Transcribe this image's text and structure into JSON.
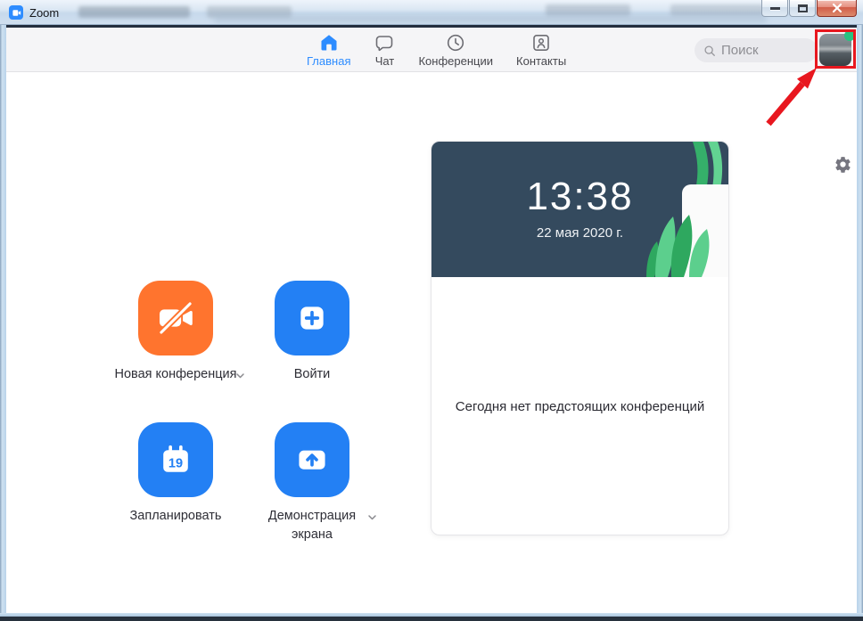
{
  "window": {
    "title": "Zoom",
    "controls": {
      "minimize": "minimize",
      "maximize": "maximize",
      "close": "close"
    }
  },
  "header": {
    "tabs": [
      {
        "label": "Главная",
        "icon": "home-icon",
        "active": true
      },
      {
        "label": "Чат",
        "icon": "chat-icon",
        "active": false
      },
      {
        "label": "Конференции",
        "icon": "meetings-clock-icon",
        "active": false
      },
      {
        "label": "Контакты",
        "icon": "contacts-icon",
        "active": false
      }
    ],
    "search_placeholder": "Поиск",
    "avatar_status": "online"
  },
  "actions": [
    {
      "label": "Новая конференция",
      "icon": "video-camera-off-icon",
      "has_dropdown": true
    },
    {
      "label": "Войти",
      "icon": "plus-icon",
      "has_dropdown": false
    },
    {
      "label": "Запланировать",
      "icon": "calendar-icon",
      "calendar_day": "19",
      "has_dropdown": false
    },
    {
      "label": "Демонстрация экрана",
      "icon": "share-screen-icon",
      "has_dropdown": true
    }
  ],
  "meeting_card": {
    "time": "13:38",
    "date": "22 мая 2020 г.",
    "empty_message": "Сегодня нет предстоящих конференций"
  },
  "colors": {
    "accent_blue": "#2380F4",
    "tab_active_blue": "#2D8CFF",
    "accent_orange": "#FF742E",
    "hero_navy": "#344A5E",
    "status_green": "#27C281",
    "annotation_red": "#E8171F"
  }
}
